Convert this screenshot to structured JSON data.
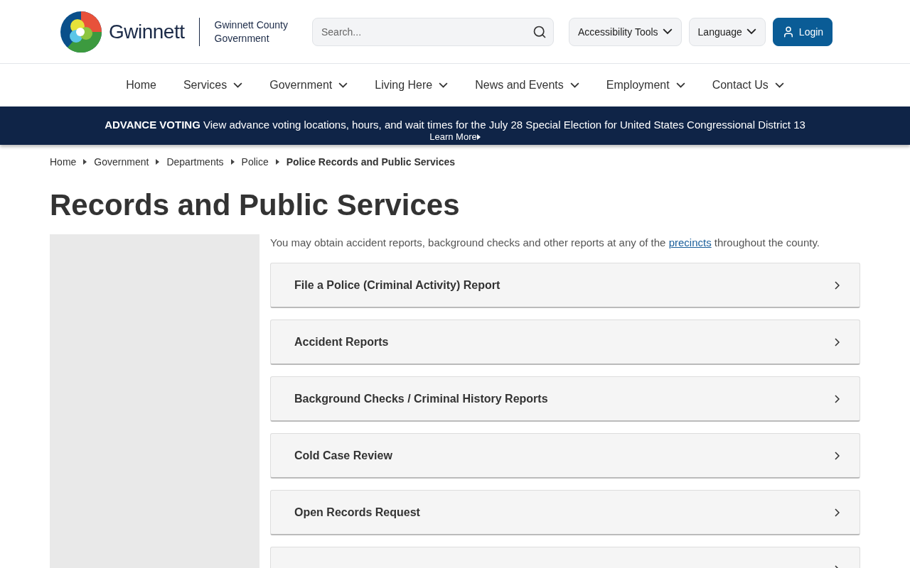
{
  "header": {
    "logo_text": "Gwinnett",
    "org_name_line1": "Gwinnett County",
    "org_name_line2": "Government",
    "search": {
      "placeholder": "Search..."
    },
    "buttons": [
      {
        "label": "Accessibility Tools",
        "kind": "dropdown"
      },
      {
        "label": "Language",
        "kind": "dropdown"
      },
      {
        "label": "Login",
        "kind": "primary"
      }
    ]
  },
  "nav": [
    {
      "label": "Home",
      "has_menu": false
    },
    {
      "label": "Services",
      "has_menu": true
    },
    {
      "label": "Government",
      "has_menu": true
    },
    {
      "label": "Living Here",
      "has_menu": true
    },
    {
      "label": "News and Events",
      "has_menu": true
    },
    {
      "label": "Employment",
      "has_menu": true
    },
    {
      "label": "Contact Us",
      "has_menu": true
    }
  ],
  "alert": {
    "heading": "ADVANCE VOTING",
    "message": "View advance voting locations, hours, and wait times for the July 28 Special Election for United States Congressional District 13",
    "link": "Learn More"
  },
  "breadcrumbs": [
    {
      "label": "Home",
      "current": false
    },
    {
      "label": "Government",
      "current": false
    },
    {
      "label": "Departments",
      "current": false
    },
    {
      "label": "Police",
      "current": false
    },
    {
      "label": "Police Records and Public Services",
      "current": true
    }
  ],
  "page_title": "Records and Public Services",
  "intro": {
    "before": "You may obtain accident reports, background checks and other reports at any of the",
    "link": "precincts",
    "after": "throughout the county."
  },
  "accordion": [
    {
      "title": "File a Police (Criminal Activity) Report",
      "expanded": false
    },
    {
      "title": "Accident Reports",
      "expanded": false
    },
    {
      "title": "Background Checks / Criminal History Reports",
      "expanded": false
    },
    {
      "title": "Cold Case Review",
      "expanded": false
    },
    {
      "title": "Open Records Request",
      "expanded": false
    },
    {
      "expanded": false
    }
  ]
}
